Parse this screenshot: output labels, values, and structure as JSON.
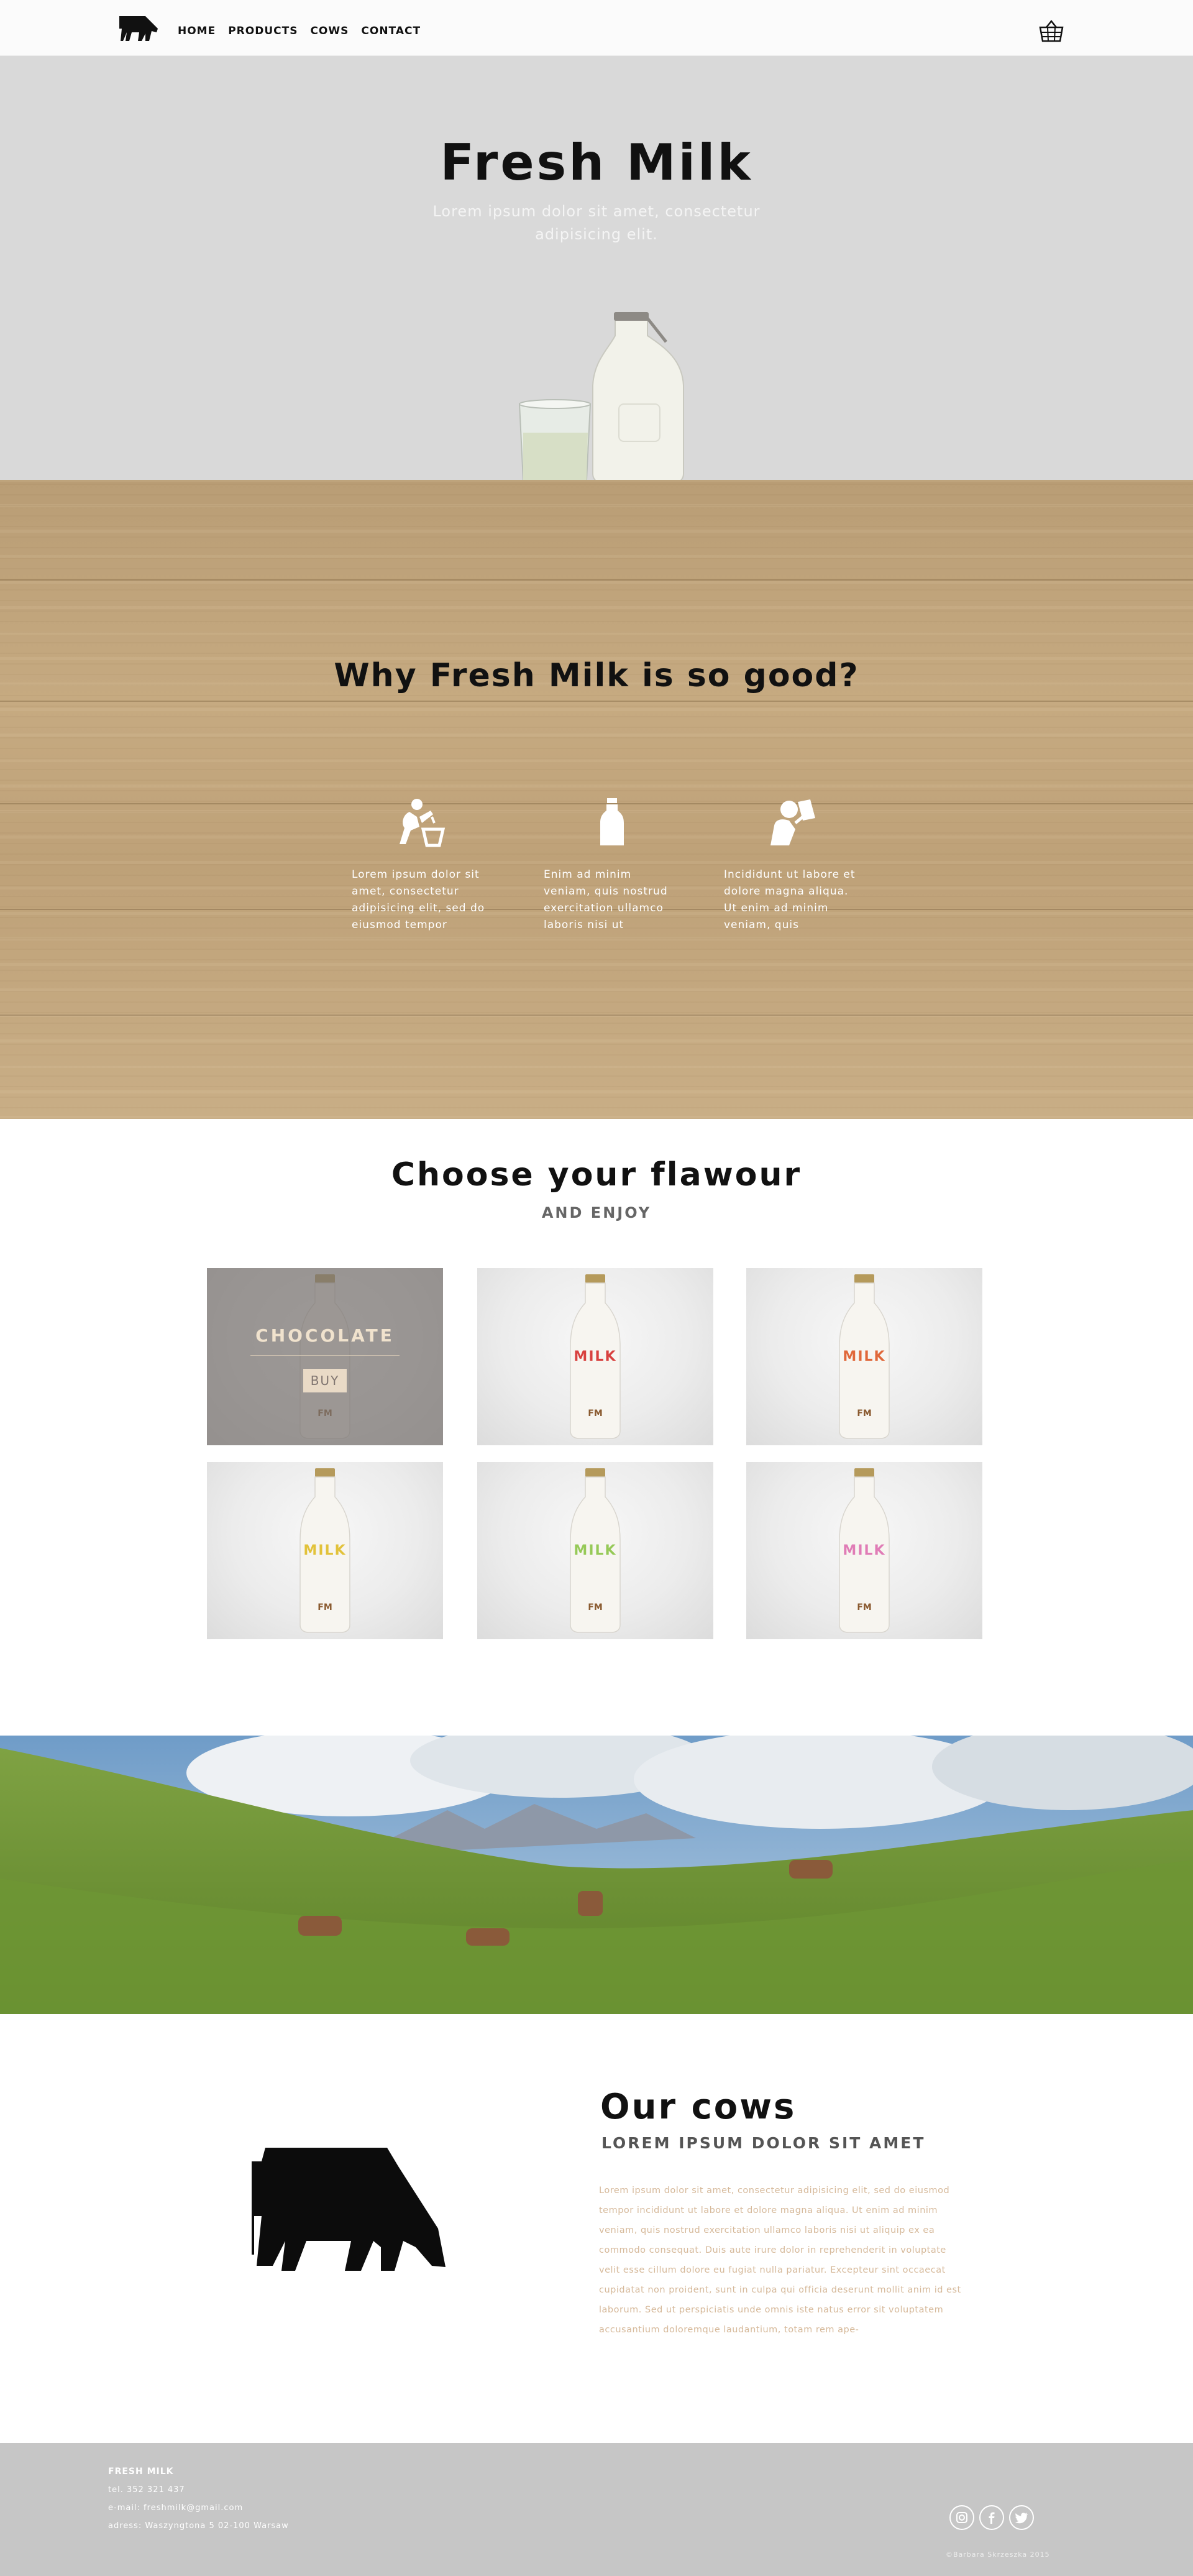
{
  "nav": {
    "logo_icon": "cow-icon",
    "items": [
      {
        "label": "HOME"
      },
      {
        "label": "PRODUCTS"
      },
      {
        "label": "COWS"
      },
      {
        "label": "CONTACT"
      }
    ],
    "cart_icon": "basket-icon"
  },
  "hero": {
    "title": "Fresh Milk",
    "subtitle": "Lorem ipsum dolor sit amet, consectetur adipisicing elit."
  },
  "why": {
    "title": "Why Fresh Milk is so good?",
    "features": [
      {
        "icon": "milking-icon",
        "text": "Lorem ipsum dolor sit amet, consectetur adipisicing elit, sed do eiusmod tempor"
      },
      {
        "icon": "milk-bottle-icon",
        "text": "Enim ad minim veniam, quis nostrud exercitation ullamco laboris nisi ut"
      },
      {
        "icon": "drinking-milk-icon",
        "text": "Incididunt ut labore et dolore magna aliqua. Ut enim ad minim veniam, quis"
      }
    ]
  },
  "flavours": {
    "title": "Choose your flawour",
    "subtitle": "AND ENJOY",
    "items": [
      {
        "label": "MILK",
        "color": "#8b5a3c",
        "overlay_title": "CHOCOLATE",
        "buy_label": "BUY"
      },
      {
        "label": "MILK",
        "color": "#d8413f"
      },
      {
        "label": "MILK",
        "color": "#e0683a"
      },
      {
        "label": "MILK",
        "color": "#e2c23a"
      },
      {
        "label": "MILK",
        "color": "#96c957"
      },
      {
        "label": "MILK",
        "color": "#e07cb6"
      }
    ]
  },
  "cows": {
    "title": "Our cows",
    "subtitle": "LOREM IPSUM DOLOR SIT AMET",
    "text": "Lorem ipsum dolor sit amet, consectetur adipisicing elit, sed do eiusmod tempor incididunt ut labore et dolore magna aliqua. Ut enim ad minim veniam, quis nostrud exercitation ullamco laboris nisi ut aliquip ex ea commodo consequat. Duis aute irure dolor in reprehenderit in voluptate velit esse cillum dolore eu fugiat nulla pariatur. Excepteur sint occaecat cupidatat non proident, sunt in culpa qui officia deserunt mollit anim id est laborum. Sed ut perspiciatis unde omnis iste natus error sit voluptatem accusantium doloremque laudantium, totam rem ape-"
  },
  "footer": {
    "name": "FRESH MILK",
    "phone": "tel. 352 321 437",
    "email": "e-mail: freshmilk@gmail.com",
    "address": "adress: Waszyngtona 5 02-100 Warsaw",
    "social": [
      "instagram-icon",
      "facebook-icon",
      "twitter-icon"
    ],
    "copyright": "©Barbara Skrzeszka 2015"
  },
  "colors": {
    "hero_bg": "#d9d9d9",
    "wood": "#c3a67d",
    "footer_bg": "#c6c6c6",
    "accent_text": "#d6b99a"
  }
}
